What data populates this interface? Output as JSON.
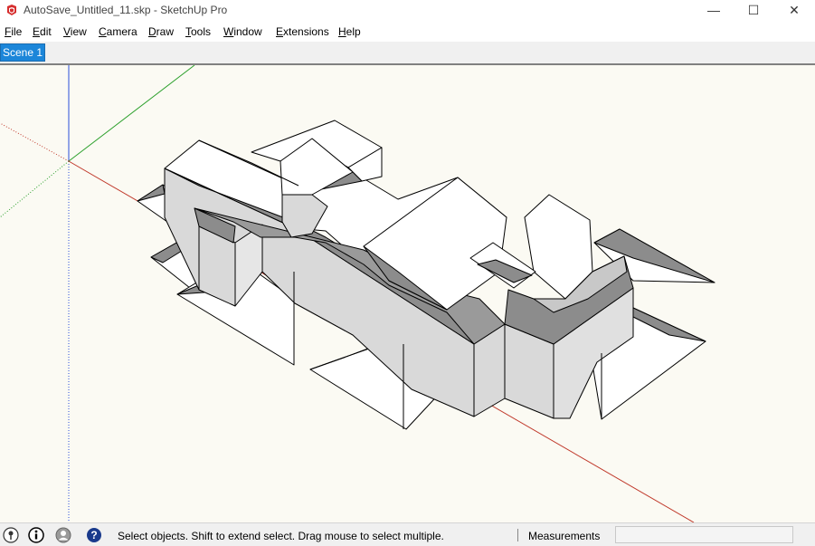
{
  "window": {
    "title": "AutoSave_Untitled_11.skp - SketchUp Pro",
    "minimize_glyph": "—",
    "maximize_glyph": "☐",
    "close_glyph": "✕"
  },
  "menu": [
    {
      "mnemonic": "F",
      "rest": "ile"
    },
    {
      "mnemonic": "E",
      "rest": "dit"
    },
    {
      "mnemonic": "V",
      "rest": "iew"
    },
    {
      "mnemonic": "C",
      "rest": "amera"
    },
    {
      "mnemonic": "D",
      "rest": "raw"
    },
    {
      "mnemonic": "T",
      "rest": "ools"
    },
    {
      "mnemonic": "W",
      "rest": "indow"
    },
    {
      "mnemonic": "E",
      "rest": "xtensions"
    },
    {
      "mnemonic": "H",
      "rest": "elp"
    }
  ],
  "scenes": {
    "active_tab": "Scene 1"
  },
  "status": {
    "message": "Select objects. Shift to extend select. Drag mouse to select multiple.",
    "measurements_label": "Measurements",
    "measurements_value": ""
  },
  "colors": {
    "accent_tab": "#1c86d9",
    "viewport_bg": "#fbfaf3",
    "axis_red": "#c0392b",
    "axis_green": "#2ca02c",
    "axis_blue": "#2b4fd8",
    "face_light": "#ffffff",
    "face_mid": "#d9d9d9",
    "face_dark": "#8c8c8c"
  },
  "icons": {
    "app": "sketchup-logo-icon",
    "geo": "geolocation-icon",
    "credits": "credits-icon",
    "user": "user-account-icon",
    "help": "help-icon"
  }
}
